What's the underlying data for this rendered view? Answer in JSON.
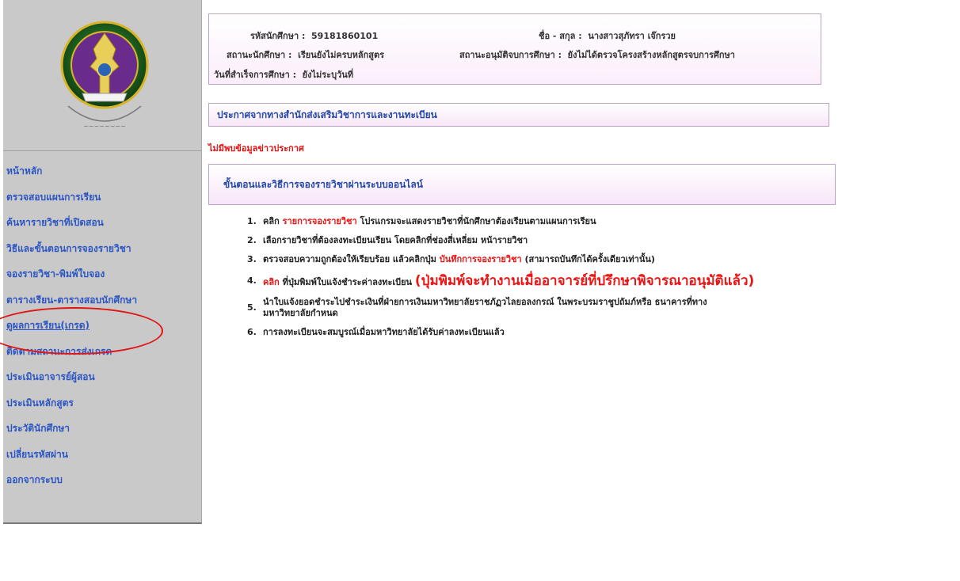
{
  "sidebar": {
    "items": [
      {
        "label": "หน้าหลัก"
      },
      {
        "label": "ตรวจสอบแผนการเรียน"
      },
      {
        "label": "ค้นหารายวิชาที่เปิดสอน"
      },
      {
        "label": "วิธีและขั้นตอนการจองรายวิชา"
      },
      {
        "label": "จองรายวิชา-พิมพ์ใบจอง"
      },
      {
        "label": "ตารางเรียน-ตารางสอบนักศึกษา"
      },
      {
        "label": "ดูผลการเรียน(เกรด)"
      },
      {
        "label": "ติดตามสถานะการส่งเกรด"
      },
      {
        "label": "ประเมินอาจารย์ผู้สอน"
      },
      {
        "label": "ประเมินหลักสูตร"
      },
      {
        "label": "ประวัตินักศึกษา"
      },
      {
        "label": "เปลี่ยนรหัสผ่าน"
      },
      {
        "label": "ออกจากระบบ"
      }
    ],
    "highlight_color": "#e01515"
  },
  "student": {
    "id_label": "รหัสนักศึกษา :",
    "id_value": "59181860101",
    "name_label": "ชื่อ - สกุล :",
    "name_value": "นางสาวสุภัทรา เจ๊กรวย",
    "status_label": "สถานะนักศึกษา :",
    "status_value": "เรียนยังไม่ครบหลักสูตร",
    "approval_label": "สถานะอนุมัติจบการศึกษา :",
    "approval_value": "ยังไม่ได้ตรวจโครงสร้างหลักสูตรจบการศึกษา",
    "grad_label": "วันที่สำเร็จการศึกษา :",
    "grad_value": "ยังไม่ระบุวันที่"
  },
  "announcement": {
    "title": "ประกาศจากทางสำนักส่งเสริมวิชาการและงานทะเบียน",
    "empty": "ไม่มีพบข้อมูลข่าวประกาศ"
  },
  "procedure": {
    "title": "ขั้นตอนและวิธีการจองรายวิชาผ่านระบบออนไลน์",
    "steps": [
      {
        "num": "1.",
        "a": "คลิก ",
        "red": "รายการจองรายวิชา",
        "b": " โปรแกรมจะแสดงรายวิชาที่นักศึกษาต้องเรียนตามแผนการเรียน"
      },
      {
        "num": "2.",
        "a": "เลือกรายวิชาที่ต้องลงทะเบียนเรียน โดยคลิกที่ช่องสี่เหลี่ยม หน้ารายวิชา"
      },
      {
        "num": "3.",
        "a": "ตรวจสอบความถูกต้องให้เรียบร้อย แล้วคลิกปุ่ม ",
        "red": "บันทึกการจองรายวิชา",
        "b": " (สามารถบันทึกได้ครั้งเดียวเท่านั้น)"
      },
      {
        "num": "4.",
        "red_start": "คลิก",
        "a": " ที่ปุ่มพิมพ์ใบแจ้งชำระค่าลงทะเบียน ",
        "big": "(ปุ่มพิมพ์จะทำงานเมื่ออาจารย์ที่ปรึกษาพิจารณาอนุมัติแล้ว)"
      },
      {
        "num": "5.",
        "a": "นำใบแจ้งยอดชำระไปชำระเงินที่ฝ่ายการเงินมหาวิทยาลัยราชภัฏวไลยอลงกรณ์ ในพระบรมราชูปถัมภ์หรือ ธนาคารที่ทาง",
        "b": "มหาวิทยาลัยกำหนด"
      },
      {
        "num": "6.",
        "a": "การลงทะเบียนจะสมบูรณ์เมื่อมหาวิทยาลัยได้รับค่าลงทะเบียนแล้ว"
      }
    ]
  }
}
